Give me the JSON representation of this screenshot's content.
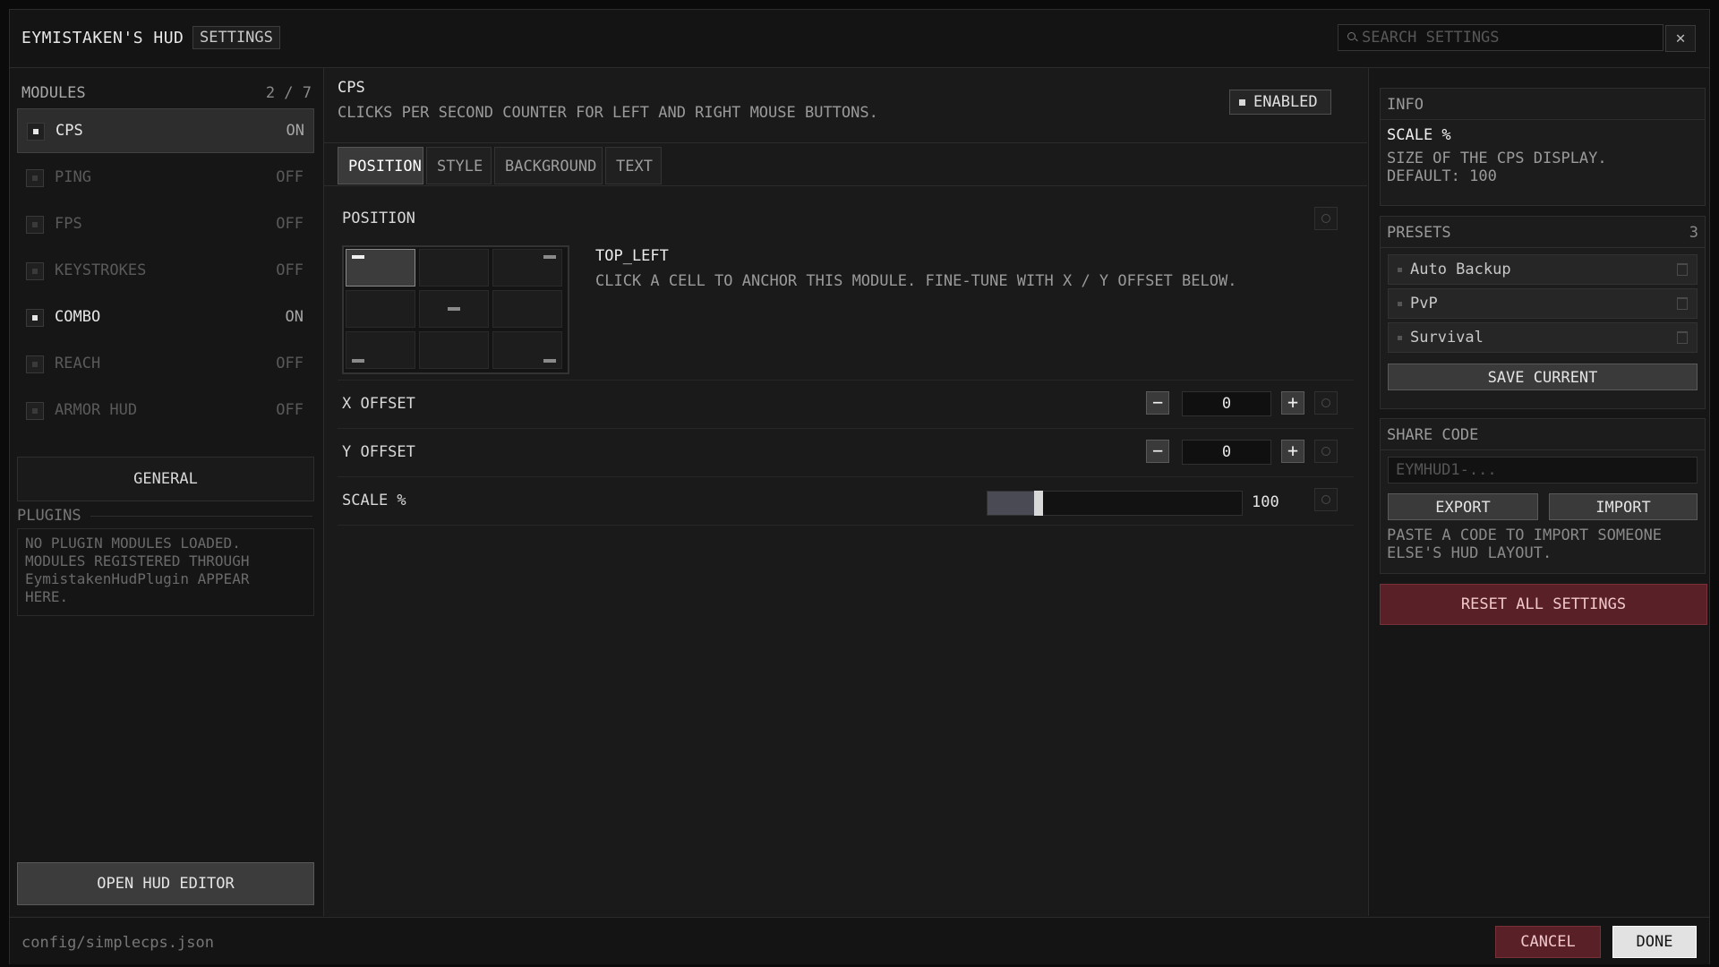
{
  "app": {
    "title": "EYMISTAKEN'S HUD",
    "tag": "SETTINGS",
    "search_placeholder": "SEARCH SETTINGS",
    "close_label": "✕"
  },
  "sidebar": {
    "header": "MODULES",
    "count": "2 / 7",
    "modules": [
      {
        "name": "CPS",
        "state": "ON"
      },
      {
        "name": "PING",
        "state": "OFF"
      },
      {
        "name": "FPS",
        "state": "OFF"
      },
      {
        "name": "KEYSTROKES",
        "state": "OFF"
      },
      {
        "name": "COMBO",
        "state": "ON"
      },
      {
        "name": "REACH",
        "state": "OFF"
      },
      {
        "name": "ARMOR HUD",
        "state": "OFF"
      }
    ],
    "general_label": "GENERAL",
    "plugins_label": "PLUGINS",
    "plugins_text_1": "NO PLUGIN MODULES LOADED.",
    "plugins_text_2": "MODULES REGISTERED THROUGH",
    "plugins_text_3": "EymistakenHudPlugin APPEAR",
    "plugins_text_4": "HERE.",
    "open_editor_label": "OPEN HUD EDITOR"
  },
  "main": {
    "module_title": "CPS",
    "module_desc": "CLICKS PER SECOND COUNTER FOR LEFT AND RIGHT MOUSE BUTTONS.",
    "enabled_label": "ENABLED",
    "tabs": [
      "POSITION",
      "STYLE",
      "BACKGROUND",
      "TEXT"
    ],
    "active_tab": "POSITION",
    "position_label": "POSITION",
    "anchor_name": "TOP_LEFT",
    "anchor_help": "CLICK A CELL TO ANCHOR THIS MODULE. FINE-TUNE WITH X / Y OFFSET BELOW.",
    "x_offset_label": "X OFFSET",
    "x_offset_value": "0",
    "y_offset_label": "Y OFFSET",
    "y_offset_value": "0",
    "scale_label": "SCALE %",
    "scale_value": "100",
    "scale_slider_fraction": 0.2,
    "minus": "−",
    "plus": "+"
  },
  "info": {
    "title": "INFO",
    "name": "SCALE %",
    "desc_1": "SIZE OF THE CPS DISPLAY.",
    "desc_2": "DEFAULT: 100"
  },
  "presets": {
    "title": "PRESETS",
    "count": "3",
    "items": [
      "Auto Backup",
      "PvP",
      "Survival"
    ],
    "save_label": "SAVE CURRENT"
  },
  "share": {
    "title": "SHARE CODE",
    "placeholder": "EYMHUD1-...",
    "export_label": "EXPORT",
    "import_label": "IMPORT",
    "help_1": "PASTE A CODE TO IMPORT SOMEONE",
    "help_2": "ELSE'S HUD LAYOUT."
  },
  "reset_all_label": "RESET ALL SETTINGS",
  "footer": {
    "path": "config/simplecps.json",
    "cancel_label": "CANCEL",
    "done_label": "DONE"
  },
  "colors": {
    "accent_danger": "#5a2028",
    "selected": "#2d2d2d",
    "background": "#181818"
  }
}
